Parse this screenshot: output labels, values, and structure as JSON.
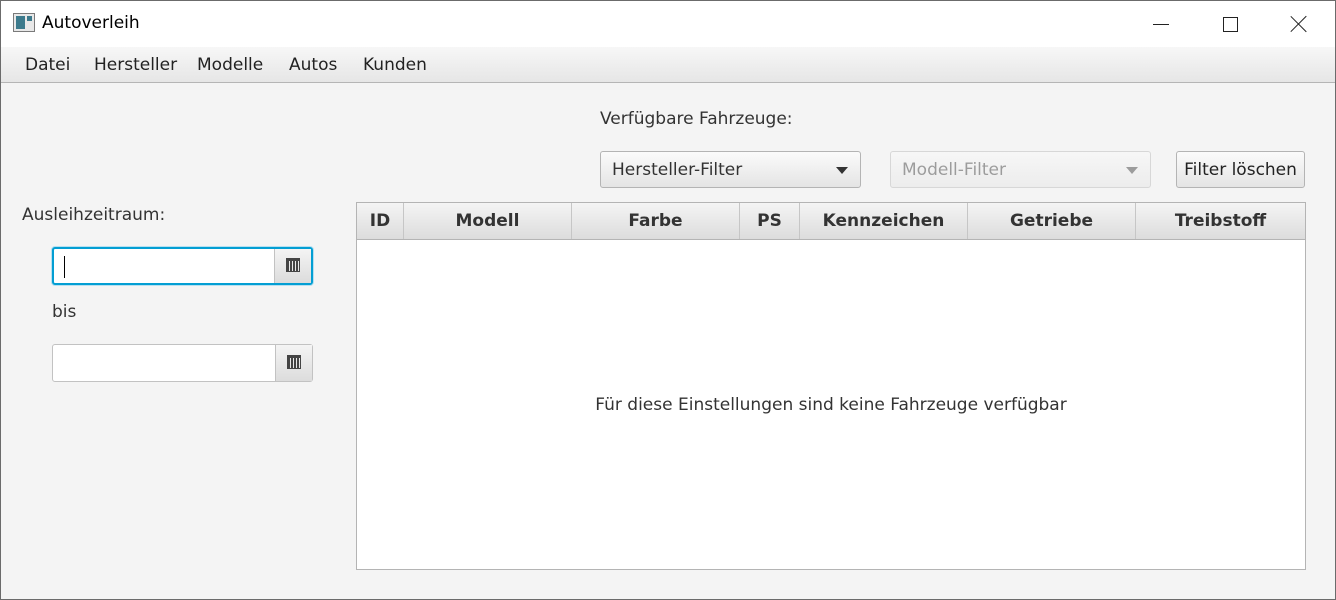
{
  "window": {
    "title": "Autoverleih"
  },
  "menu": {
    "items": [
      "Datei",
      "Hersteller",
      "Modelle",
      "Autos",
      "Kunden"
    ]
  },
  "filters": {
    "heading": "Verfügbare Fahrzeuge:",
    "manufacturer_placeholder": "Hersteller-Filter",
    "model_placeholder": "Modell-Filter",
    "model_filter_enabled": false,
    "clear_button": "Filter löschen"
  },
  "rental_period": {
    "label": "Ausleihzeitraum:",
    "from_value": "",
    "separator": "bis",
    "to_value": ""
  },
  "table": {
    "columns": [
      "ID",
      "Modell",
      "Farbe",
      "PS",
      "Kennzeichen",
      "Getriebe",
      "Treibstoff"
    ],
    "rows": [],
    "empty_message": "Für diese Einstellungen sind keine Fahrzeuge verfügbar"
  },
  "colors": {
    "focus_accent": "#039ed3",
    "icon_accent": "#3c7a8c"
  }
}
